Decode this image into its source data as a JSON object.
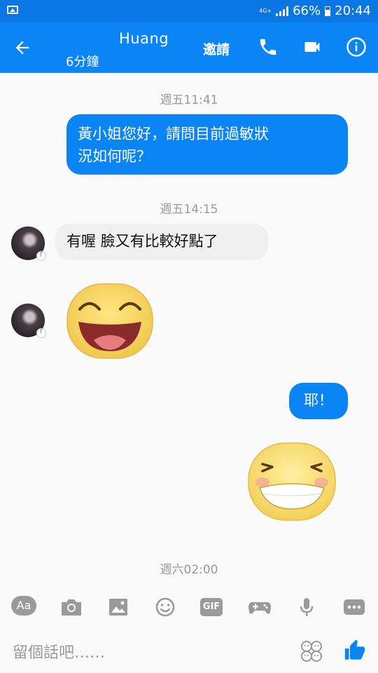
{
  "status_bar": {
    "network": "4G+",
    "battery": "66%",
    "time": "20:44"
  },
  "header": {
    "name": "Huang",
    "subtitle": "6分鐘",
    "invite_label": "邀請"
  },
  "messages": [
    {
      "timestamp": "週五11:41"
    },
    {
      "from": "me",
      "text_line1": "黃小姐您好，請問目前過敏狀",
      "text_line2": "況如何呢？"
    },
    {
      "timestamp": "週五14:15"
    },
    {
      "from": "them",
      "text": "有喔 臉又有比較好點了"
    },
    {
      "from": "them",
      "sticker": "laughing-face-sticker"
    },
    {
      "from": "me",
      "text": "耶！"
    },
    {
      "from": "me",
      "sticker": "grinning-face-sticker"
    },
    {
      "timestamp": "週六02:00"
    }
  ],
  "toolbar": {
    "text_style_label": "Aa",
    "gif_label": "GIF",
    "icons": [
      "text-style-icon",
      "camera-icon",
      "image-icon",
      "emoji-icon",
      "gif-icon",
      "game-controller-icon",
      "microphone-icon",
      "more-icon"
    ]
  },
  "composer": {
    "placeholder": "留個話吧……"
  },
  "colors": {
    "header": "#0b84f6",
    "statusbar": "#0a76e3",
    "outgoing_bubble": "#0b84f6",
    "incoming_bubble": "#f0f0f0"
  }
}
